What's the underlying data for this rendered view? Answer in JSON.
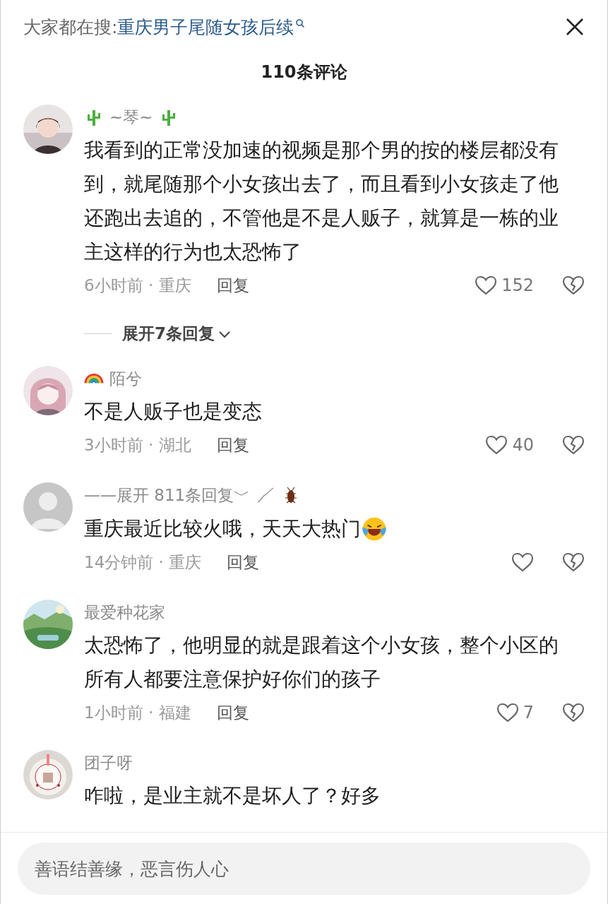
{
  "search_bar": {
    "label": "大家都在搜:",
    "link": "重庆男子尾随女孩后续"
  },
  "title": "110条评论",
  "comments": [
    {
      "avatar": {
        "kind": "person"
      },
      "name_parts": [
        {
          "kind": "cactus"
        },
        {
          "kind": "text",
          "text": "~琴~"
        },
        {
          "kind": "cactus"
        }
      ],
      "body": [
        {
          "kind": "text",
          "text": "我看到的正常没加速的视频是那个男的按的楼层都没有到，就尾随那个小女孩出去了，而且看到小女孩走了他还跑出去追的，不管他是不是人贩子，就算是一栋的业主这样的行为也太恐怖了"
        }
      ],
      "time_location": "6小时前 · 重庆",
      "reply": "回复",
      "likes": "152",
      "replies_toggle": "展开7条回复"
    },
    {
      "avatar": {
        "kind": "drawing"
      },
      "name_parts": [
        {
          "kind": "rainbow"
        },
        {
          "kind": "text",
          "text": "陌兮"
        }
      ],
      "body": [
        {
          "kind": "text",
          "text": "不是人贩子也是变态"
        }
      ],
      "time_location": "3小时前 · 湖北",
      "reply": "回复",
      "likes": "40"
    },
    {
      "avatar": {
        "kind": "default"
      },
      "name_parts": [
        {
          "kind": "text",
          "text": "——展开 811条回复﹀"
        },
        {
          "kind": "squiggle"
        },
        {
          "kind": "cockroach"
        }
      ],
      "body": [
        {
          "kind": "text",
          "text": "重庆最近比较火哦，天天大热门"
        },
        {
          "kind": "laugh"
        }
      ],
      "time_location": "14分钟前 · 重庆",
      "reply": "回复"
    },
    {
      "avatar": {
        "kind": "landscape"
      },
      "name_parts": [
        {
          "kind": "text",
          "text": "最爱种花家"
        }
      ],
      "body": [
        {
          "kind": "text",
          "text": "太恐怖了，他明显的就是跟着这个小女孩，整个小区的所有人都要注意保护好你们的孩子"
        }
      ],
      "time_location": "1小时前 · 福建",
      "reply": "回复",
      "likes": "7"
    },
    {
      "avatar": {
        "kind": "cake"
      },
      "name_parts": [
        {
          "kind": "text",
          "text": "团子呀"
        }
      ],
      "body": [
        {
          "kind": "text",
          "text": "咋啦，是业主就不是坏人了？好多"
        }
      ]
    }
  ],
  "input": {
    "placeholder": "善语结善缘，恶言伤人心"
  }
}
